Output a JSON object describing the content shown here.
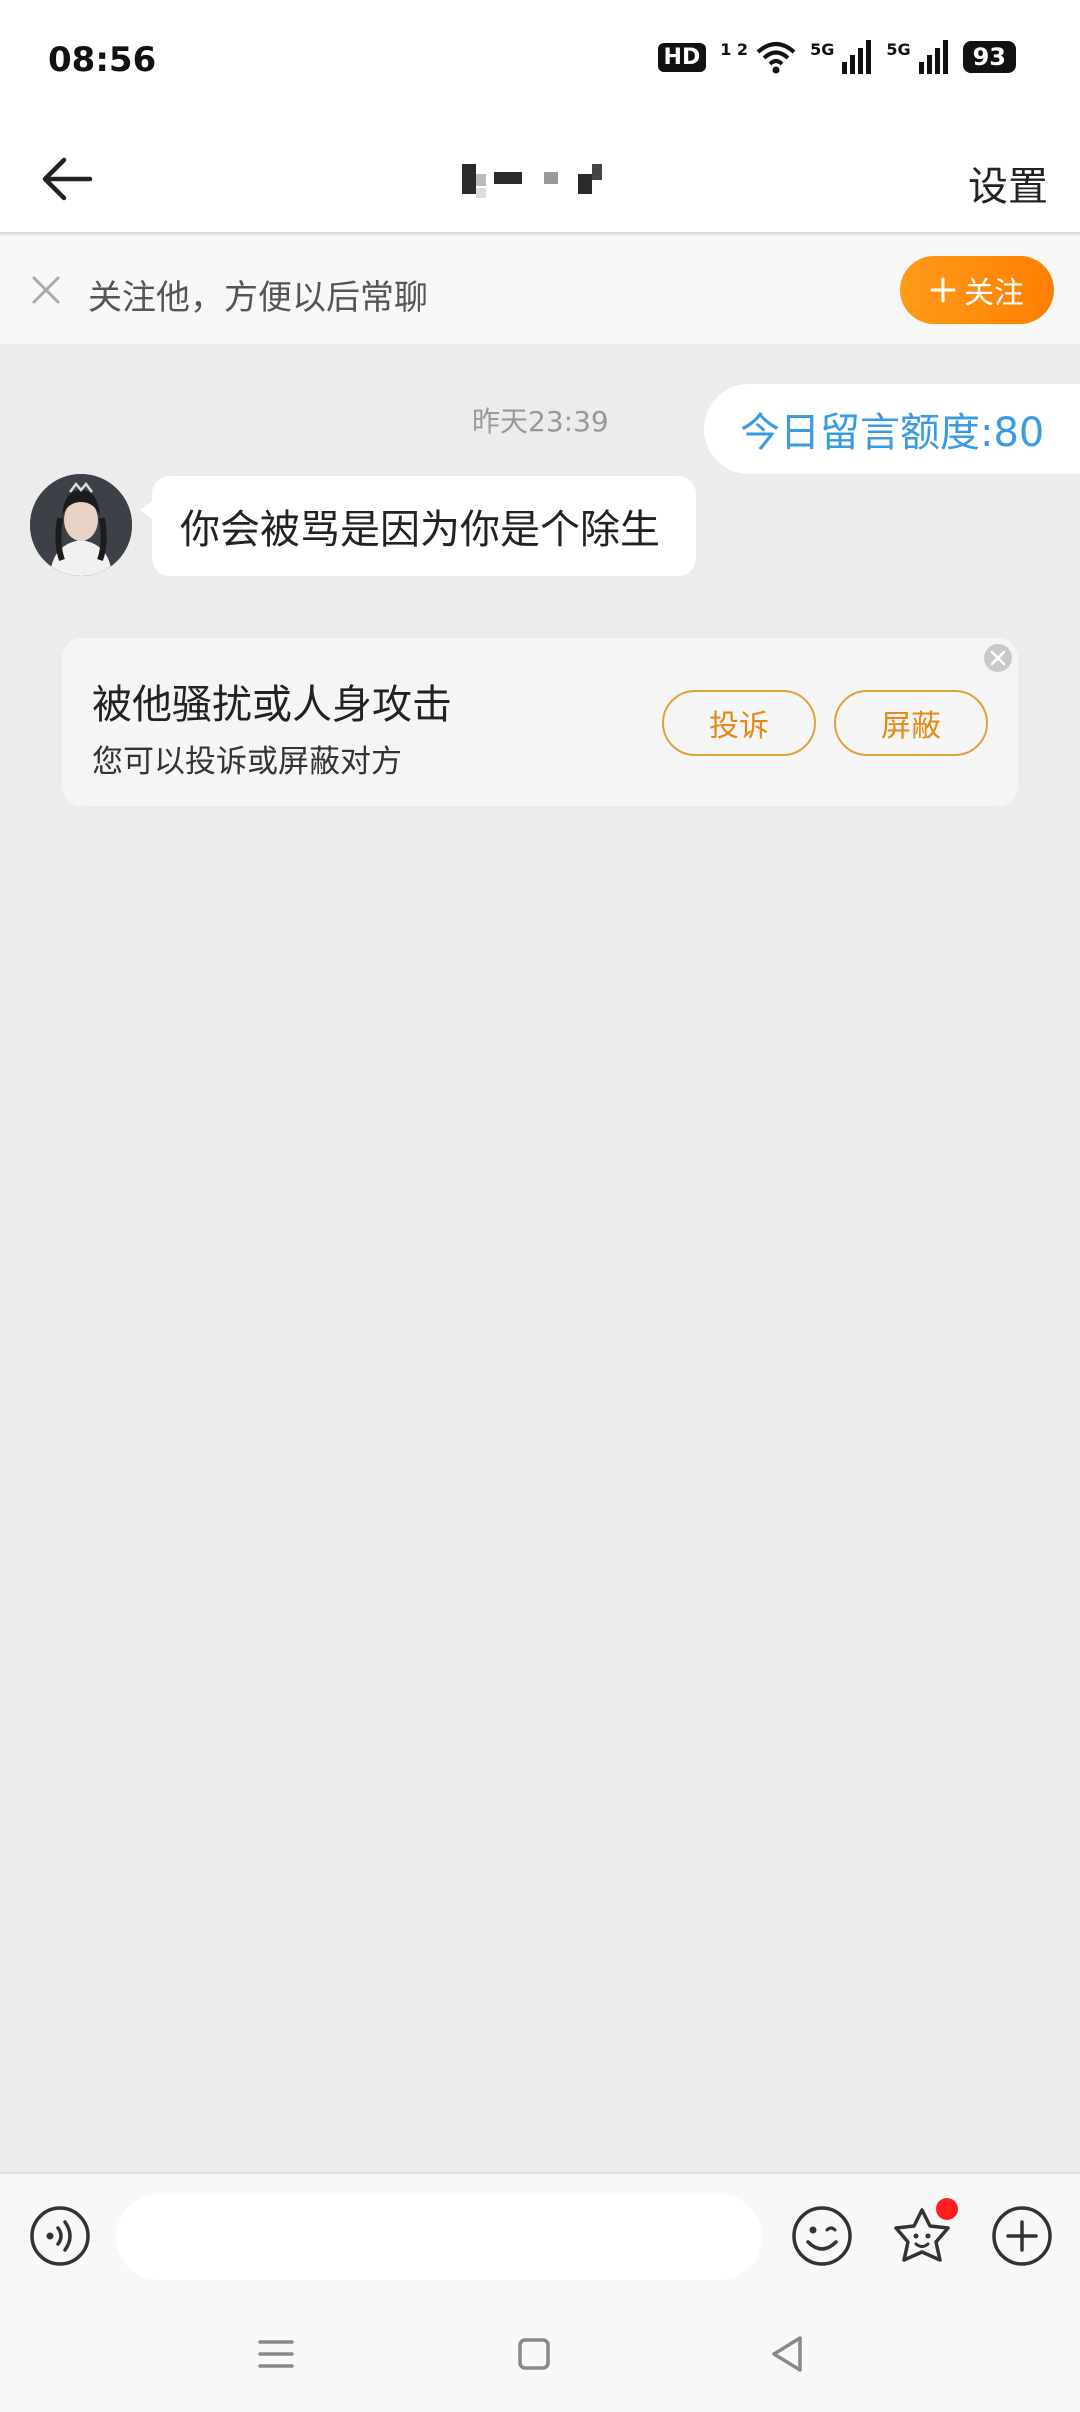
{
  "status": {
    "time": "08:56",
    "hd_label": "HD",
    "hd_sub": "1 2",
    "network_1": "5G",
    "network_2": "5G",
    "battery": "93",
    "icons": [
      "hd-voice-icon",
      "wifi-icon",
      "signal-icon",
      "signal-icon",
      "battery-icon"
    ]
  },
  "nav": {
    "back_icon": "arrow-left-icon",
    "title": "",
    "settings_label": "设置"
  },
  "follow_banner": {
    "text": "关注他，方便以后常聊",
    "button_label": "关注",
    "close_icon": "close-icon",
    "button_color": "#ff8c0a"
  },
  "chat": {
    "timestamp": "昨天23:39",
    "quota_text": "今日留言额度:80",
    "quota_color": "#3a9be0",
    "message": "你会被骂是因为你是个除生"
  },
  "harassment_card": {
    "title": "被他骚扰或人身攻击",
    "subtitle": "您可以投诉或屏蔽对方",
    "report_label": "投诉",
    "block_label": "屏蔽",
    "accent_color": "#e38a17"
  },
  "input_bar": {
    "voice_icon": "voice-icon",
    "emoji_icon": "emoji-icon",
    "sticker_icon": "sticker-icon",
    "plus_icon": "plus-circle-icon",
    "input_value": "",
    "input_placeholder": ""
  },
  "system_nav": {
    "icons": [
      "menu-icon",
      "home-icon",
      "back-triangle-icon"
    ]
  }
}
